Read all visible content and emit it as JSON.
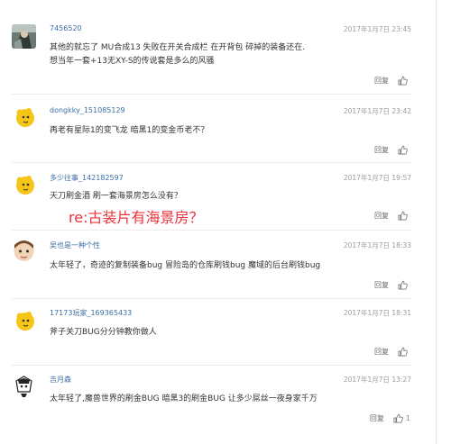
{
  "comments": [
    {
      "username": "7456520",
      "time": "2017年1月7日 23:45",
      "lines": [
        "其他的就忘了 MU合成13 失败在开关合成栏 在开背包 碎掉的装备还在.",
        "想当年一套+13无XY-S的传说套是多么的风骚"
      ],
      "reply": "回复",
      "likes": ""
    },
    {
      "username": "dongkky_151085129",
      "time": "2017年1月7日 23:42",
      "lines": [
        "再老有星际1的变飞龙 暗黑1的变金币老不？"
      ],
      "reply": "回复",
      "likes": ""
    },
    {
      "username": "多少往事_142182597",
      "time": "2017年1月7日 19:57",
      "lines": [
        "天刀刷金酒 刷一套海景房怎么没有？"
      ],
      "reply": "回复",
      "likes": ""
    },
    {
      "username": "吴也是一种个性",
      "time": "2017年1月7日 18:33",
      "lines": [
        "太年轻了，奇迹的复制装备bug 冒险岛的仓库刷钱bug 魔域的后台刷钱bug"
      ],
      "reply": "回复",
      "likes": ""
    },
    {
      "username": "17173玩家_169365433",
      "time": "2017年1月7日 18:31",
      "lines": [
        "斧子关刀BUG分分钟教你做人"
      ],
      "reply": "回复",
      "likes": ""
    },
    {
      "username": "吉月森",
      "time": "2017年1月7日 13:27",
      "lines": [
        "太年轻了,魔兽世界的刷金BUG 暗黑3的刷金BUG 让多少屌丝一夜身家千万"
      ],
      "reply": "回复",
      "likes": "1"
    }
  ],
  "annotation": "re:古装片有海景房？",
  "colors": {
    "username": "#3b6ea5",
    "annotation": "#e8333b",
    "time": "#9a9a9a"
  },
  "icons": {
    "like": "thumbs-up-icon"
  }
}
